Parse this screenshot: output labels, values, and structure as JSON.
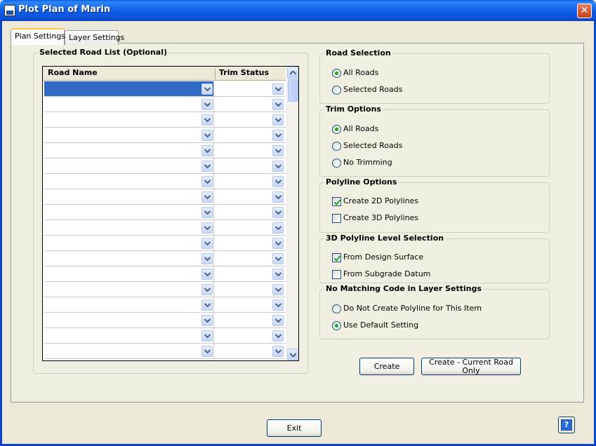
{
  "window": {
    "title": "Plot Plan of Marin",
    "close_symbol": "✕"
  },
  "tabs": [
    {
      "label": "Plan Settings",
      "active": true
    },
    {
      "label": "Layer Settings",
      "active": false
    }
  ],
  "road_list": {
    "title": "Selected Road List (Optional)",
    "columns": [
      "Road Name",
      "Trim Status"
    ],
    "row_count": 18,
    "selected_row": 0
  },
  "road_selection": {
    "title": "Road Selection",
    "options": [
      {
        "label": "All Roads",
        "checked": true
      },
      {
        "label": "Selected Roads",
        "checked": false
      }
    ]
  },
  "trim_options": {
    "title": "Trim Options",
    "options": [
      {
        "label": "All Roads",
        "checked": true
      },
      {
        "label": "Selected Roads",
        "checked": false
      },
      {
        "label": "No Trimming",
        "checked": false
      }
    ]
  },
  "polyline_options": {
    "title": "Polyline Options",
    "options": [
      {
        "label": "Create 2D Polylines",
        "checked": true
      },
      {
        "label": "Create 3D Polylines",
        "checked": false
      }
    ]
  },
  "level_selection": {
    "title": "3D Polyline Level Selection",
    "options": [
      {
        "label": "From Design Surface",
        "checked": true
      },
      {
        "label": "From Subgrade Datum",
        "checked": false
      }
    ]
  },
  "no_matching": {
    "title": "No Matching Code in Layer Settings",
    "options": [
      {
        "label": "Do Not Create Polyline for This Item",
        "checked": false
      },
      {
        "label": "Use Default Setting",
        "checked": true
      }
    ]
  },
  "buttons": {
    "create": "Create",
    "create_current_line1": "Create - Current Road",
    "create_current_line2": "Only",
    "exit": "Exit",
    "help": "?"
  },
  "colors": {
    "selection": "#316AC5",
    "title_bar": "#0A5FE3",
    "radio_dot": "#21A121"
  }
}
